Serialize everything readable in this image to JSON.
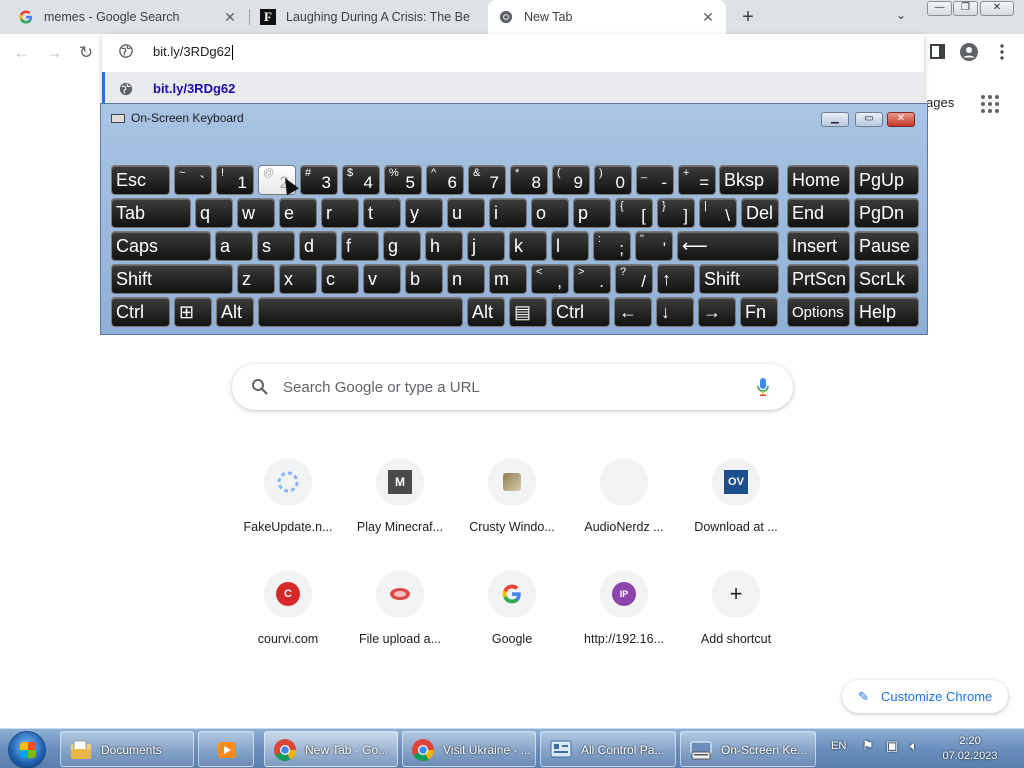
{
  "tabs": [
    {
      "title": "memes - Google Search",
      "icon": "google-g-icon",
      "close": "✕"
    },
    {
      "title": "Laughing During A Crisis: The Be",
      "icon": "forbes-f-icon",
      "close": "✕"
    },
    {
      "title": "New Tab",
      "icon": "chrome-icon",
      "close": "✕"
    }
  ],
  "tabstrip": {
    "new_tab": "+",
    "dropdown": "⌄"
  },
  "window_controls": {
    "minimize": "—",
    "restore": "❐",
    "close": "✕"
  },
  "omnibox": {
    "url": "bit.ly/3RDg62",
    "suggestion": "bit.ly/3RDg62"
  },
  "page": {
    "images_peek": "ages",
    "search_placeholder": "Search Google or type a URL",
    "shortcuts": [
      {
        "label": "FakeUpdate.n...",
        "icon": "loading-spinner-icon"
      },
      {
        "label": "Play Minecraf...",
        "icon": "minecraft-m-icon",
        "glyph": "M"
      },
      {
        "label": "Crusty Windo...",
        "icon": "crusty-windows-icon"
      },
      {
        "label": "AudioNerdz ...",
        "icon": "blank-icon"
      },
      {
        "label": "Download at ...",
        "icon": "ov-logo-icon",
        "glyph": "OV"
      },
      {
        "label": "courvi.com",
        "icon": "courvi-c-icon",
        "glyph": "C"
      },
      {
        "label": "File upload a...",
        "icon": "file-upload-icon"
      },
      {
        "label": "Google",
        "icon": "google-g-icon",
        "glyph": "G"
      },
      {
        "label": "http://192.16...",
        "icon": "ip-icon",
        "glyph": "IP"
      },
      {
        "label": "Add shortcut",
        "icon": "plus-icon",
        "glyph": "+"
      }
    ],
    "customize_label": "Customize Chrome"
  },
  "osk": {
    "title": "On-Screen Keyboard",
    "rows": [
      [
        {
          "id": "esc",
          "main": "Esc"
        },
        {
          "id": "tilde",
          "sh": "~",
          "lo": "`"
        },
        {
          "id": "1",
          "sh": "!",
          "lo": "1"
        },
        {
          "id": "2",
          "sh": "@",
          "lo": "2",
          "pressed": true
        },
        {
          "id": "3",
          "sh": "#",
          "lo": "3"
        },
        {
          "id": "4",
          "sh": "$",
          "lo": "4"
        },
        {
          "id": "5",
          "sh": "%",
          "lo": "5"
        },
        {
          "id": "6",
          "sh": "^",
          "lo": "6"
        },
        {
          "id": "7",
          "sh": "&",
          "lo": "7"
        },
        {
          "id": "8",
          "sh": "*",
          "lo": "8"
        },
        {
          "id": "9",
          "sh": "(",
          "lo": "9"
        },
        {
          "id": "0",
          "sh": ")",
          "lo": "0"
        },
        {
          "id": "minus",
          "sh": "_",
          "lo": "-"
        },
        {
          "id": "equals",
          "sh": "+",
          "lo": "="
        },
        {
          "id": "bksp",
          "main": "Bksp"
        },
        {
          "id": "home",
          "main": "Home"
        },
        {
          "id": "pgup",
          "main": "PgUp"
        }
      ],
      [
        {
          "id": "tab",
          "main": "Tab"
        },
        {
          "id": "q",
          "main": "q"
        },
        {
          "id": "w",
          "main": "w"
        },
        {
          "id": "e",
          "main": "e"
        },
        {
          "id": "r",
          "main": "r"
        },
        {
          "id": "t",
          "main": "t"
        },
        {
          "id": "y",
          "main": "y"
        },
        {
          "id": "u",
          "main": "u"
        },
        {
          "id": "i",
          "main": "i"
        },
        {
          "id": "o",
          "main": "o"
        },
        {
          "id": "p",
          "main": "p"
        },
        {
          "id": "lbracket",
          "sh": "{",
          "lo": "["
        },
        {
          "id": "rbracket",
          "sh": "}",
          "lo": "]"
        },
        {
          "id": "backslash",
          "sh": "|",
          "lo": "\\"
        },
        {
          "id": "del",
          "main": "Del"
        },
        {
          "id": "end",
          "main": "End"
        },
        {
          "id": "pgdn",
          "main": "PgDn"
        }
      ],
      [
        {
          "id": "caps",
          "main": "Caps"
        },
        {
          "id": "a",
          "main": "a"
        },
        {
          "id": "s",
          "main": "s"
        },
        {
          "id": "d",
          "main": "d"
        },
        {
          "id": "f",
          "main": "f"
        },
        {
          "id": "g",
          "main": "g"
        },
        {
          "id": "h",
          "main": "h"
        },
        {
          "id": "j",
          "main": "j"
        },
        {
          "id": "k",
          "main": "k"
        },
        {
          "id": "l",
          "main": "l"
        },
        {
          "id": "semicolon",
          "sh": ":",
          "lo": ";"
        },
        {
          "id": "quote",
          "sh": "\"",
          "lo": "'"
        },
        {
          "id": "enter",
          "main": "⟵"
        },
        {
          "id": "insert",
          "main": "Insert"
        },
        {
          "id": "pause",
          "main": "Pause"
        }
      ],
      [
        {
          "id": "lshift",
          "main": "Shift"
        },
        {
          "id": "z",
          "main": "z"
        },
        {
          "id": "x",
          "main": "x"
        },
        {
          "id": "c",
          "main": "c"
        },
        {
          "id": "v",
          "main": "v"
        },
        {
          "id": "b",
          "main": "b"
        },
        {
          "id": "n",
          "main": "n"
        },
        {
          "id": "m",
          "main": "m"
        },
        {
          "id": "comma",
          "sh": "<",
          "lo": ","
        },
        {
          "id": "period",
          "sh": ">",
          "lo": "."
        },
        {
          "id": "slash",
          "sh": "?",
          "lo": "/"
        },
        {
          "id": "up",
          "main": "↑"
        },
        {
          "id": "rshift",
          "main": "Shift"
        },
        {
          "id": "prtscn",
          "main": "PrtScn"
        },
        {
          "id": "scrlk",
          "main": "ScrLk"
        }
      ],
      [
        {
          "id": "lctrl",
          "main": "Ctrl"
        },
        {
          "id": "win",
          "main": "⊞"
        },
        {
          "id": "lalt",
          "main": "Alt"
        },
        {
          "id": "space",
          "main": ""
        },
        {
          "id": "ralt",
          "main": "Alt"
        },
        {
          "id": "menu",
          "main": "▤"
        },
        {
          "id": "rctrl",
          "main": "Ctrl"
        },
        {
          "id": "left",
          "main": "←"
        },
        {
          "id": "down",
          "main": "↓"
        },
        {
          "id": "right",
          "main": "→"
        },
        {
          "id": "fn",
          "main": "Fn"
        },
        {
          "id": "options",
          "main": "Options",
          "small": true
        },
        {
          "id": "help",
          "main": "Help"
        }
      ]
    ]
  },
  "taskbar": {
    "items": [
      {
        "label": "Documents",
        "icon": "folder-libraries-icon"
      },
      {
        "label": "",
        "icon": "media-player-icon"
      },
      {
        "label": "New Tab - Go...",
        "icon": "chrome-icon",
        "active": true
      },
      {
        "label": "Visit Ukraine - ...",
        "icon": "chrome-icon"
      },
      {
        "label": "All Control Pa...",
        "icon": "control-panel-icon"
      },
      {
        "label": "On-Screen Ke...",
        "icon": "keyboard-icon"
      }
    ],
    "lang": "EN",
    "time": "2:20",
    "date": "07.02.2023"
  },
  "colors": {
    "accent": "#1a73e8",
    "tabstrip": "#dee1e6",
    "osk_bg": "#a9c4e4"
  }
}
